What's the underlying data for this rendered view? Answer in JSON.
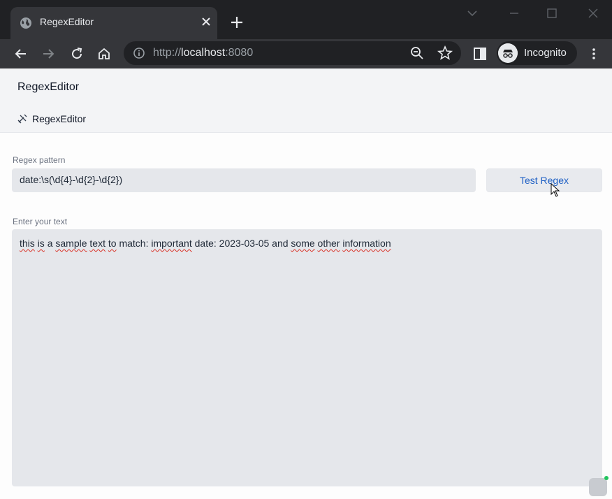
{
  "browser": {
    "tab_title": "RegexEditor",
    "url_scheme": "http://",
    "url_host": "localhost",
    "url_port": ":8080",
    "profile_label": "Incognito"
  },
  "app": {
    "title": "RegexEditor",
    "nav_label": "RegexEditor"
  },
  "form": {
    "pattern_label": "Regex pattern",
    "pattern_value": "date:\\s(\\d{4}-\\d{2}-\\d{2})",
    "test_button_label": "Test Regex",
    "text_label": "Enter your text",
    "text_segments": [
      {
        "text": "this",
        "misspelled": true
      },
      {
        "text": " "
      },
      {
        "text": "is",
        "misspelled": true
      },
      {
        "text": " a "
      },
      {
        "text": "sample",
        "misspelled": true
      },
      {
        "text": " "
      },
      {
        "text": "text",
        "misspelled": true
      },
      {
        "text": " "
      },
      {
        "text": "to",
        "misspelled": true
      },
      {
        "text": " match: "
      },
      {
        "text": "important",
        "misspelled": true
      },
      {
        "text": " date: 2023-03-05 and "
      },
      {
        "text": "some",
        "misspelled": true
      },
      {
        "text": " "
      },
      {
        "text": "other",
        "misspelled": true
      },
      {
        "text": " "
      },
      {
        "text": "information",
        "misspelled": true
      }
    ]
  },
  "colors": {
    "chrome_dark": "#202124",
    "chrome_toolbar": "#35363a",
    "input_bg": "#e5e7eb",
    "accent_link": "#1d5fc4"
  }
}
